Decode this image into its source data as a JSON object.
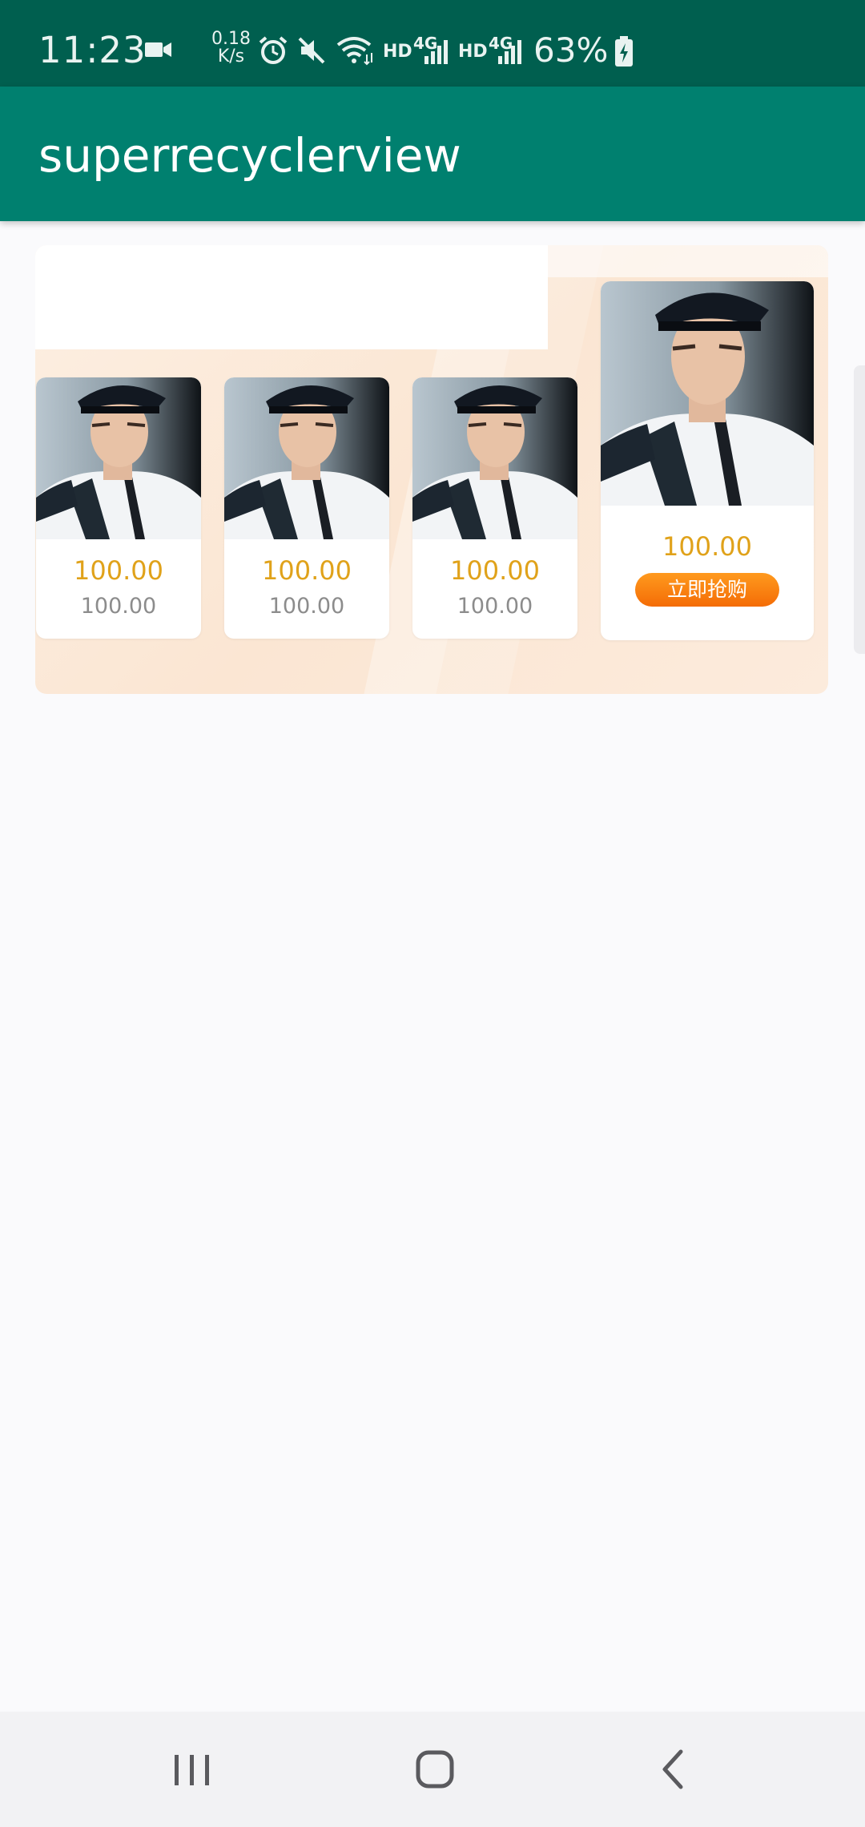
{
  "status_bar": {
    "time": "11:23",
    "net_rate_value": "0.18",
    "net_rate_unit": "K/s",
    "hd_label_1": "HD",
    "hd_label_2": "HD",
    "net_type_1": "4G",
    "net_type_2": "4G",
    "battery_percent": "63%",
    "icons": [
      "video-camera-icon",
      "alarm-icon",
      "mute-icon",
      "wifi-icon",
      "signal-icon",
      "signal-icon",
      "battery-charging-icon"
    ]
  },
  "app_bar": {
    "title": "superrecyclerview",
    "color": "#00806f"
  },
  "products": [
    {
      "price": "100.00",
      "old_price": "100.00"
    },
    {
      "price": "100.00",
      "old_price": "100.00"
    },
    {
      "price": "100.00",
      "old_price": "100.00"
    },
    {
      "price": "100.00",
      "button_label": "立即抢购"
    }
  ],
  "colors": {
    "status_bar": "#005f4f",
    "price": "#e0a21a",
    "button": "#f46c06"
  },
  "nav_bar": {
    "items": [
      "recent-apps-icon",
      "home-icon",
      "back-icon"
    ]
  }
}
